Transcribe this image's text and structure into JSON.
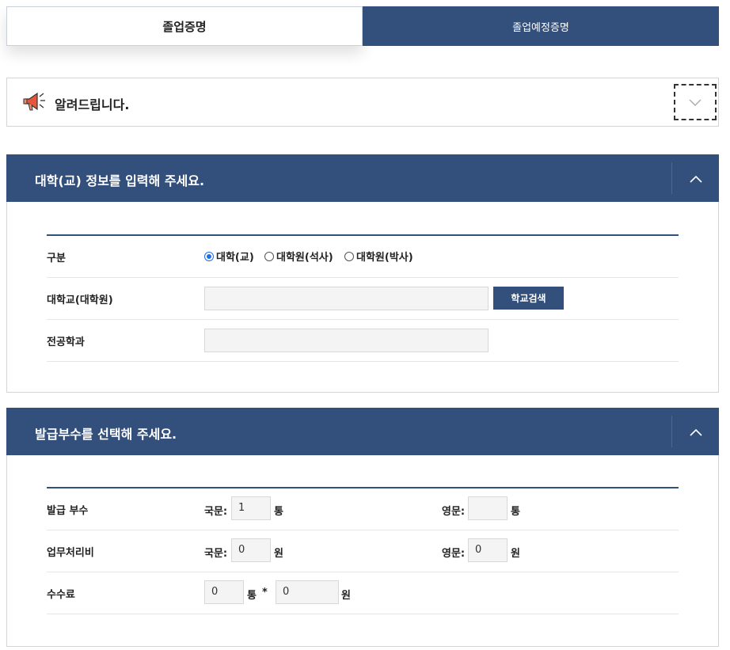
{
  "tabs": [
    {
      "label": "졸업증명",
      "active": true
    },
    {
      "label": "졸업예정증명",
      "active": false
    }
  ],
  "notice": {
    "title": "알려드립니다.",
    "icon": "megaphone-icon",
    "toggle_icon": "chevron-down-icon"
  },
  "section1": {
    "title": "대학(교) 정보를 입력해 주세요.",
    "collapse_icon": "chevron-up-icon",
    "rows": {
      "type_label": "구분",
      "radios": [
        "대학(교)",
        "대학원(석사)",
        "대학원(박사)"
      ],
      "selected": "대학(교)",
      "school_label": "대학교(대학원)",
      "school_value": "",
      "search_button": "학교검색",
      "major_label": "전공학과",
      "major_value": ""
    }
  },
  "section2": {
    "title": "발급부수를 선택해 주세요.",
    "collapse_icon": "chevron-up-icon",
    "copies": {
      "label": "발급 부수",
      "korean_label": "국문:",
      "korean_value": "1",
      "korean_unit": "통",
      "english_label": "영문:",
      "english_value": "",
      "english_unit": "통"
    },
    "fee": {
      "label": "업무처리비",
      "korean_label": "국문:",
      "korean_value": "0",
      "korean_unit": "원",
      "english_label": "영문:",
      "english_value": "0",
      "english_unit": "원"
    },
    "commission": {
      "label": "수수료",
      "count_value": "0",
      "count_unit": "통",
      "times": "*",
      "amount_value": "0",
      "amount_unit": "원"
    }
  },
  "colors": {
    "primary": "#334f7c",
    "radio_selected": "#1e6ee6",
    "input_bg": "#f4f4f4"
  }
}
